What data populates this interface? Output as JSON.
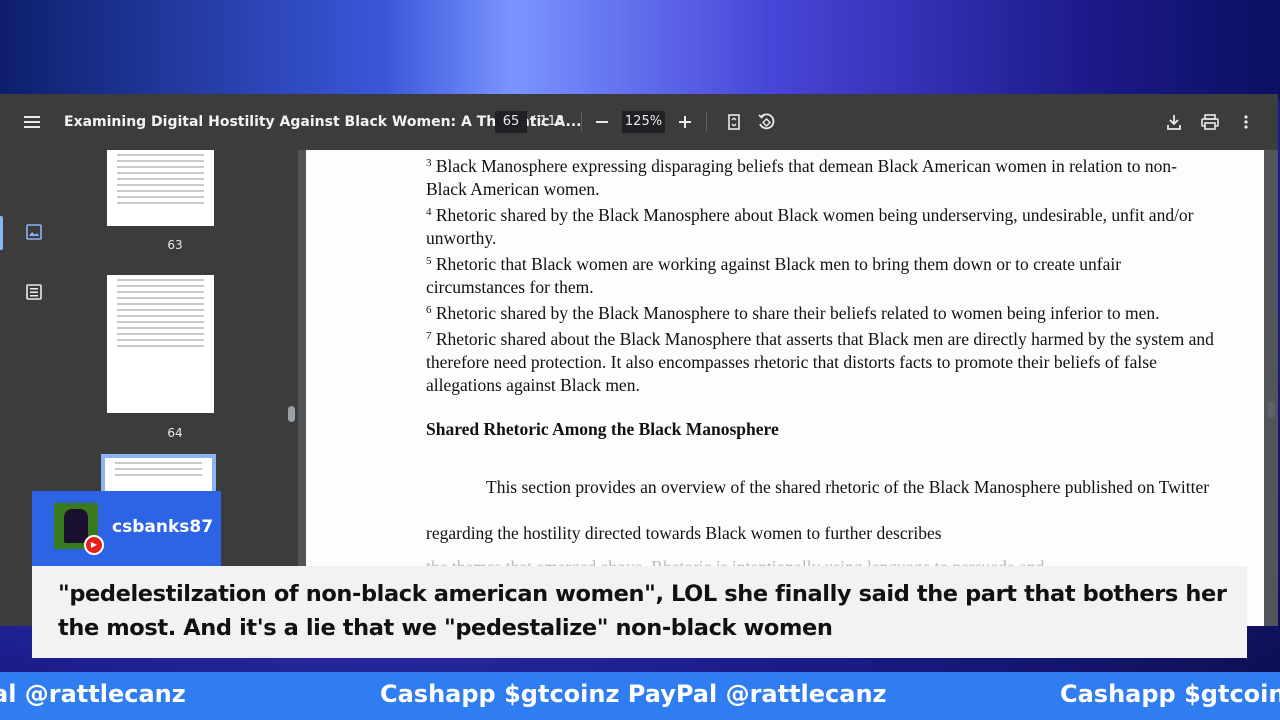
{
  "viewer": {
    "title": "Examining Digital Hostility Against Black Women: A Thematic A...",
    "current_page": "65",
    "total_pages": "/ 113",
    "zoom": "125%",
    "icons": {
      "menu": "menu-icon",
      "zoom_out": "minus-icon",
      "zoom_in": "plus-icon",
      "fit": "fit-page-icon",
      "rotate": "rotate-icon",
      "download": "download-icon",
      "print": "print-icon",
      "more": "more-vert-icon"
    }
  },
  "sidebar": {
    "thumbnail_labels": [
      "63",
      "64"
    ]
  },
  "document": {
    "footnotes": [
      {
        "num": "3",
        "text": "Black Manosphere expressing disparaging beliefs that demean Black American women in relation to non-Black American women."
      },
      {
        "num": "4",
        "text": "Rhetoric shared by the Black Manosphere about Black women being underserving, undesirable, unfit and/or unworthy."
      },
      {
        "num": "5",
        "text": "Rhetoric that Black women are working against Black men to bring them down or to create unfair circumstances for them."
      },
      {
        "num": "6",
        "text": "Rhetoric shared by the Black Manosphere to share their beliefs related to women being inferior to men."
      },
      {
        "num": "7",
        "text": "Rhetoric shared about the Black Manosphere that asserts that Black men are directly harmed by the system and therefore need protection. It also encompasses rhetoric that distorts facts to promote their beliefs of false allegations against Black men."
      }
    ],
    "heading": "Shared Rhetoric Among the Black Manosphere",
    "paragraph": "This section provides an overview of the shared rhetoric of the Black Manosphere published on Twitter regarding the hostility directed towards Black women to further describes",
    "faded_line": "the themes that emerged above. Rhetoric is intentionally using language to persuade and"
  },
  "chat": {
    "username": "csbanks87",
    "message": "\"pedelestilzation of non-black american women\", LOL she finally said the part that bothers her the most. And it's a lie that we \"pedestalize\" non-black women"
  },
  "ticker": {
    "left": "al @rattlecanz",
    "middle": "Cashapp $gtcoinz PayPal @rattlecanz",
    "right": "Cashapp $gtcoin"
  }
}
